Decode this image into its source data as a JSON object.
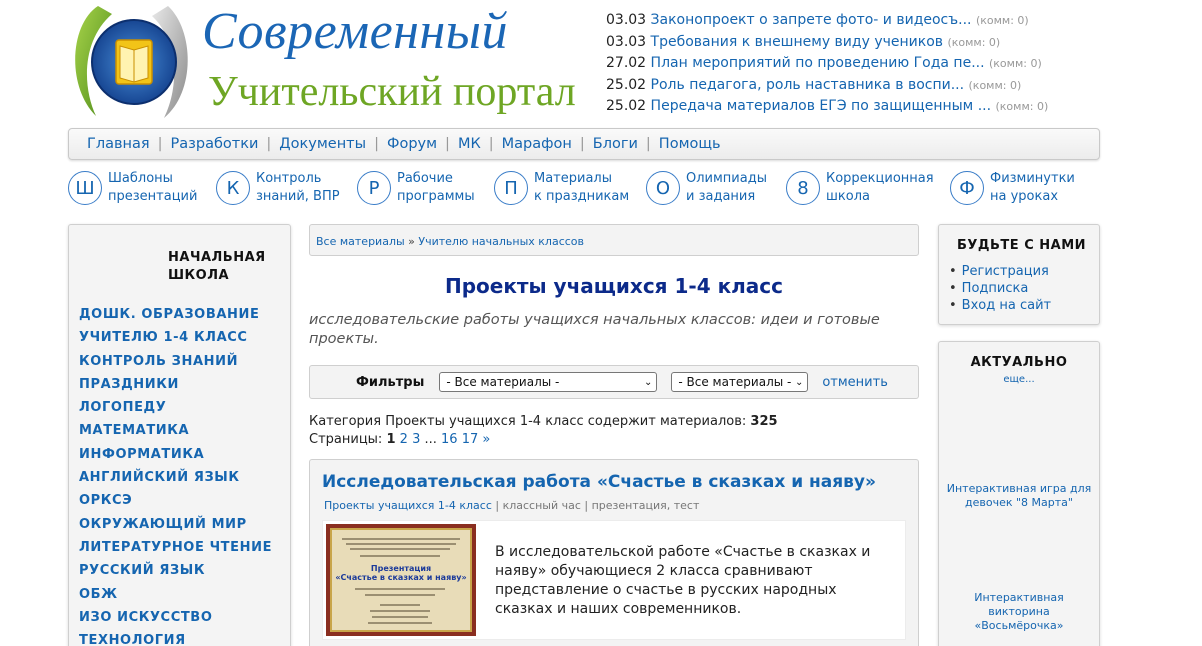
{
  "header": {
    "logo_line1": "Современный",
    "logo_line2": "Учительский портал"
  },
  "news": [
    {
      "date": "03.03",
      "title": "Законопроект о запрете фото- и видеосъ...",
      "comments": "(комм: 0)"
    },
    {
      "date": "03.03",
      "title": "Требования к внешнему виду учеников",
      "comments": "(комм: 0)"
    },
    {
      "date": "27.02",
      "title": "План мероприятий по проведению Года пе...",
      "comments": "(комм: 0)"
    },
    {
      "date": "25.02",
      "title": "Роль педагога, роль наставника в воспи...",
      "comments": "(комм: 0)"
    },
    {
      "date": "25.02",
      "title": "Передача материалов ЕГЭ по защищенным ...",
      "comments": "(комм: 0)"
    }
  ],
  "topnav": [
    "Главная",
    "Разработки",
    "Документы",
    "Форум",
    "МК",
    "Марафон",
    "Блоги",
    "Помощь"
  ],
  "categories": [
    {
      "letter": "Ш",
      "label": "Шаблоны\nпрезентаций"
    },
    {
      "letter": "К",
      "label": "Контроль\nзнаний, ВПР"
    },
    {
      "letter": "Р",
      "label": "Рабочие\nпрограммы"
    },
    {
      "letter": "П",
      "label": "Материалы\nк праздникам"
    },
    {
      "letter": "О",
      "label": "Олимпиады\nи задания"
    },
    {
      "letter": "8",
      "label": "Коррекционная\nшкола"
    },
    {
      "letter": "Ф",
      "label": "Физминутки\nна уроках"
    }
  ],
  "left_sidebar": {
    "heading": "НАЧАЛЬНАЯ\nШКОЛА",
    "items": [
      "ДОШК. ОБРАЗОВАНИЕ",
      "УЧИТЕЛЮ 1-4 КЛАСС",
      "КОНТРОЛЬ ЗНАНИЙ",
      "ПРАЗДНИКИ",
      "ЛОГОПЕДУ",
      "МАТЕМАТИКА",
      "ИНФОРМАТИКА",
      "АНГЛИЙСКИЙ ЯЗЫК",
      "ОРКСЭ",
      "ОКРУЖАЮЩИЙ МИР",
      "ЛИТЕРАТУРНОЕ ЧТЕНИЕ",
      "РУССКИЙ ЯЗЫК",
      "ОБЖ",
      "ИЗО ИСКУССТВО",
      "ТЕХНОЛОГИЯ"
    ]
  },
  "main": {
    "breadcrumb": {
      "root": "Все материалы",
      "sep": "»",
      "current": "Учителю начальных классов"
    },
    "title": "Проекты учащихся 1-4 класс",
    "description": "исследовательские работы учащихся начальных классов: идеи и готовые проекты.",
    "filters": {
      "label": "Фильтры",
      "select1": "- Все материалы -",
      "select2": "- Все материалы -",
      "cancel": "отменить"
    },
    "category_info": {
      "prefix": "Категория Проекты учащихся 1-4 класс содержит материалов:",
      "count": "325",
      "pages_label": "Страницы:",
      "current_page": "1",
      "pages": [
        "2",
        "3"
      ],
      "ellipsis": "...",
      "last_pages": [
        "16",
        "17"
      ],
      "next": "»"
    },
    "article": {
      "title": "Исследовательская работа «Счастье в сказках и наяву»",
      "category": "Проекты учащихся 1-4 класс",
      "tags": "| классный час | презентация, тест",
      "thumb_caption": "Презентация\n«Счастье в сказках и наяву»",
      "text": "В исследовательской работе «Счастье в сказках и наяву» обучающиеся 2 класса сравнивают представление о счастье в русских народных сказках и наших современников."
    }
  },
  "right_sidebar": {
    "join": {
      "heading": "БУДЬТЕ С НАМИ",
      "items": [
        "Регистрация",
        "Подписка",
        "Вход на сайт"
      ]
    },
    "actual": {
      "heading": "АКТУАЛЬНО",
      "more": "еще...",
      "items": [
        "Интерактивная игра для\nдевочек \"8 Марта\"",
        "Интерактивная\nвикторина\n«Восьмёрочка»"
      ]
    }
  }
}
